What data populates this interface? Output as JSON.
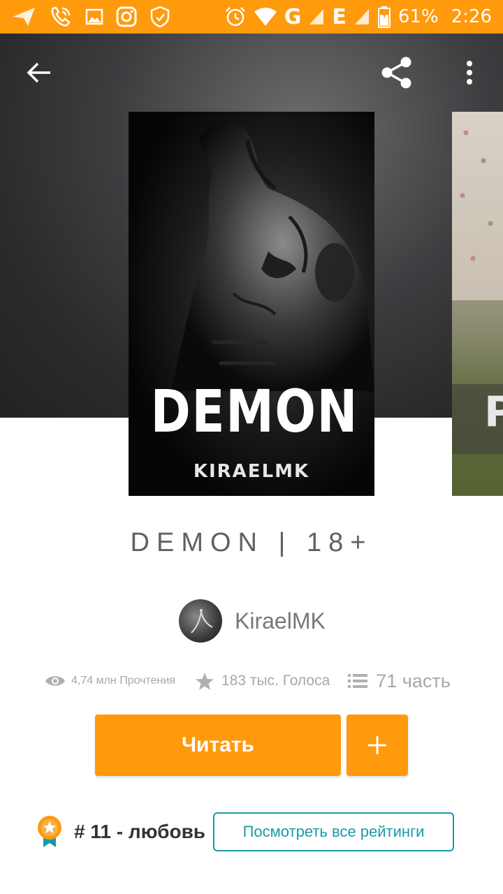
{
  "status_bar": {
    "battery": "61%",
    "time": "2:26",
    "network_g": "G",
    "network_e": "E",
    "color": "#ff9a0c"
  },
  "toolbar": {
    "back_icon": "arrow-left-icon",
    "share_icon": "share-icon",
    "more_icon": "more-vert-icon"
  },
  "cover": {
    "title": "DEMON",
    "author": "KIRAELMK",
    "next_cover_letter": "P"
  },
  "book": {
    "title": "DEMON | 18+",
    "author": "KiraelMK"
  },
  "stats": {
    "reads": "4,74 млн Прочтения",
    "votes": "183 тыс. Голоса",
    "parts": "71 часть"
  },
  "actions": {
    "read_label": "Читать",
    "add_icon": "plus-icon",
    "accent": "#ff9a0c"
  },
  "ranking": {
    "rank_text": "# 11 - любовь",
    "view_all_label": "Посмотреть все рейтинги",
    "button_color": "#1a9aa8"
  }
}
